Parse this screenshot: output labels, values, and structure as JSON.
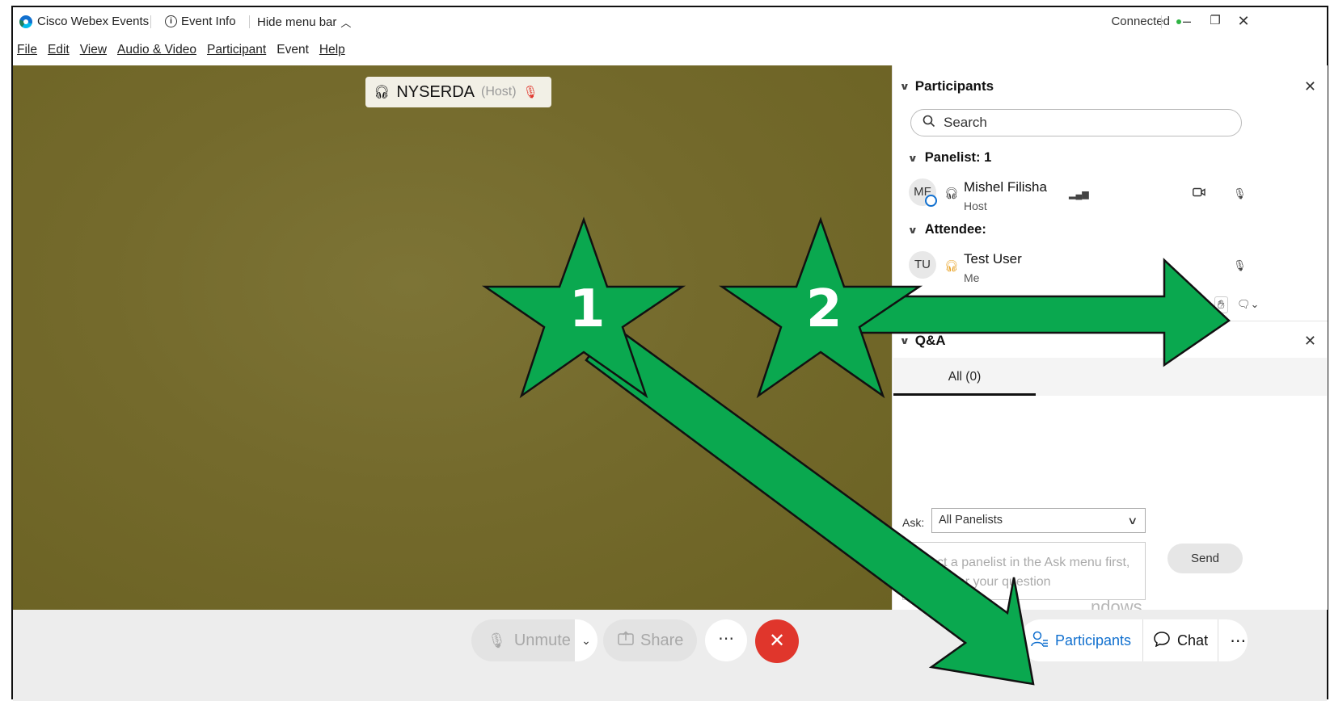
{
  "titlebar": {
    "app_name": "Cisco Webex Events",
    "event_info": "Event Info",
    "hide_menu_bar": "Hide menu bar",
    "connection_status": "Connected",
    "minimize": "–",
    "restore": "❐",
    "close": "✕"
  },
  "menubar": {
    "items": [
      "File",
      "Edit",
      "View",
      "Audio & Video",
      "Participant",
      "Event",
      "Help"
    ]
  },
  "video": {
    "host_name": "NYSERDA",
    "host_role": "(Host)"
  },
  "participants_panel": {
    "title": "Participants",
    "search_placeholder": "Search",
    "panelist_group": "Panelist: 1",
    "attendee_group": "Attendee:",
    "panelists": [
      {
        "initials": "MF",
        "name": "Mishel Filisha",
        "role": "Host"
      }
    ],
    "attendees": [
      {
        "initials": "TU",
        "name": "Test User",
        "role": "Me"
      }
    ]
  },
  "qa_panel": {
    "title": "Q&A",
    "tab_all": "All (0)",
    "ask_label": "Ask:",
    "ask_selected": "All Panelists",
    "question_placeholder": "Select a panelist in the Ask menu first, then enter your question",
    "send_label": "Send",
    "watermark": "ndows"
  },
  "bottombar": {
    "unmute_label": "Unmute",
    "share_label": "Share",
    "more_label": "⋯",
    "participants_label": "Participants",
    "chat_label": "Chat",
    "right_more_label": "⋯"
  },
  "annotations": {
    "star1_label": "1",
    "star2_label": "2",
    "star_color": "#0aa84f",
    "arrow_color": "#0aa84f"
  },
  "colors": {
    "accent": "#1170cf",
    "leave": "#e0362c",
    "connected": "#2fb344",
    "video_bg": "#746a2c"
  }
}
